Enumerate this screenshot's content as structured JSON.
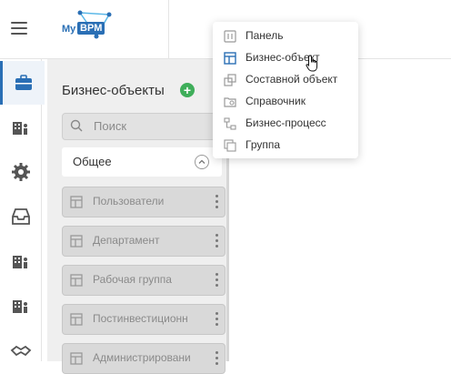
{
  "header": {
    "logo_prefix": "My",
    "logo_brand": "BPM",
    "menu_icon": "hamburger-icon"
  },
  "rail": {
    "items": [
      {
        "icon": "briefcase-icon",
        "active": true
      },
      {
        "icon": "building-person-icon",
        "active": false
      },
      {
        "icon": "gear-icon",
        "active": false
      },
      {
        "icon": "inbox-tray-icon",
        "active": false
      },
      {
        "icon": "building-person-icon",
        "active": false
      },
      {
        "icon": "building-person-icon",
        "active": false
      },
      {
        "icon": "handshake-icon",
        "active": false
      }
    ]
  },
  "panel": {
    "title": "Бизнес-объекты",
    "search_placeholder": "Поиск",
    "section_label": "Общее",
    "objects": [
      {
        "label": "Пользователи"
      },
      {
        "label": "Департамент"
      },
      {
        "label": "Рабочая группа"
      },
      {
        "label": "Постинвестиционн"
      },
      {
        "label": "Администрировани"
      }
    ]
  },
  "dropdown": {
    "items": [
      {
        "label": "Панель",
        "icon": "panel-icon"
      },
      {
        "label": "Бизнес-объект",
        "icon": "business-object-icon"
      },
      {
        "label": "Составной объект",
        "icon": "composite-object-icon"
      },
      {
        "label": "Справочник",
        "icon": "directory-icon"
      },
      {
        "label": "Бизнес-процесс",
        "icon": "business-process-icon"
      },
      {
        "label": "Группа",
        "icon": "group-icon"
      }
    ]
  },
  "colors": {
    "brand": "#2a6fb5",
    "add_button": "#3fae5a",
    "panel_bg": "#efefef"
  }
}
